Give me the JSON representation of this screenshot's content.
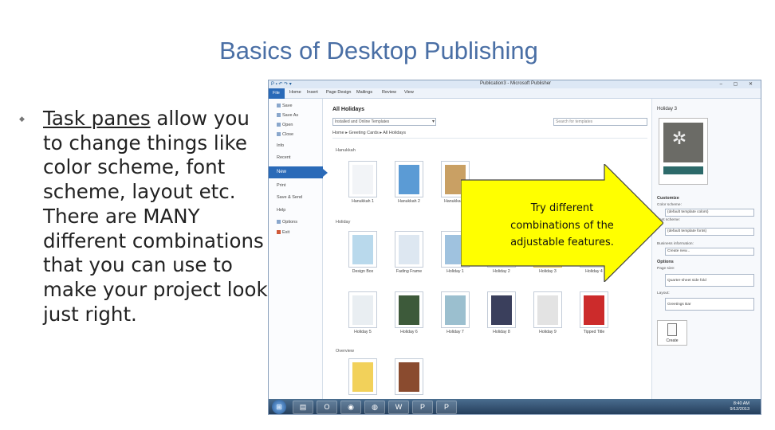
{
  "slide": {
    "title": "Basics of Desktop Publishing",
    "bullet_underlined": "Task panes",
    "bullet_rest": " allow you to change things like color scheme, font scheme, layout etc. There are MANY different combinations that you can use to make your project look just right.",
    "callout": "Try different combinations of the adjustable features."
  },
  "window": {
    "title": "Publication3 - Microsoft Publisher",
    "tabs": [
      "File",
      "Home",
      "Insert",
      "Page Design",
      "Mailings",
      "Review",
      "View"
    ]
  },
  "backstage": {
    "items": [
      "Save",
      "Save As",
      "Open",
      "Close",
      "Info",
      "Recent",
      "New",
      "Print",
      "Save & Send",
      "Help",
      "Options",
      "Exit"
    ],
    "selected": "New"
  },
  "gallery": {
    "heading": "All Holidays",
    "source": "Installed and Online Templates",
    "search_placeholder": "Search for templates",
    "breadcrumb": "Home ▸ Greeting Cards ▸ All Holidays",
    "groups": [
      "Hanukkah",
      "Holiday",
      "Overview"
    ],
    "row1": [
      "Hanukkah 1",
      "Hanukkah 2",
      "Hanukkah 3"
    ],
    "row2": [
      "Design Box",
      "Fading Frame",
      "Holiday 1",
      "Holiday 2",
      "Holiday 3",
      "Holiday 4"
    ],
    "row3": [
      "Holiday 5",
      "Holiday 6",
      "Holiday 7",
      "Holiday 8",
      "Holiday 9",
      "Tipped Title"
    ],
    "selected": "Holiday 3"
  },
  "task_pane": {
    "title": "Holiday 3",
    "customize": "Customize",
    "color_scheme_label": "Color scheme:",
    "color_scheme_value": "(default template colors)",
    "font_scheme_label": "Font scheme:",
    "font_scheme_value": "(default template fonts)",
    "business_info_label": "Business information:",
    "business_info_value": "Create new...",
    "options": "Options",
    "page_size_label": "Page size:",
    "page_size_value": "Quarter-sheet side fold",
    "layout_label": "Layout:",
    "layout_value": "Greetings Bar",
    "create_button": "Create"
  },
  "taskbar": {
    "time": "8:40 AM",
    "date": "9/12/2013"
  }
}
